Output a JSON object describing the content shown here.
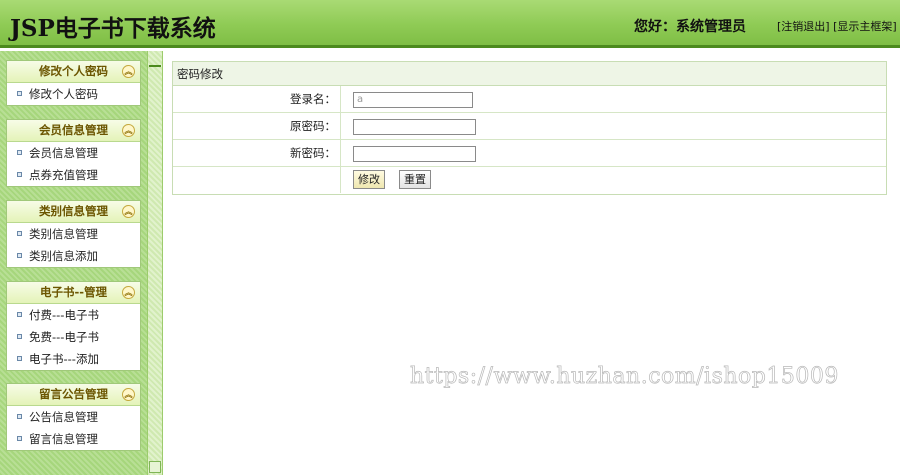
{
  "header": {
    "title": "JSP电子书下载系统",
    "greeting": "您好：系统管理员",
    "logout_link": "[注销退出]",
    "main_frame_link": "[显示主框架]"
  },
  "sidebar": {
    "groups": [
      {
        "title": "修改个人密码",
        "items": [
          "修改个人密码"
        ]
      },
      {
        "title": "会员信息管理",
        "items": [
          "会员信息管理",
          "点券充值管理"
        ]
      },
      {
        "title": "类别信息管理",
        "items": [
          "类别信息管理",
          "类别信息添加"
        ]
      },
      {
        "title": "电子书--管理",
        "items": [
          "付费---电子书",
          "免费---电子书",
          "电子书---添加"
        ]
      },
      {
        "title": "留言公告管理",
        "items": [
          "公告信息管理",
          "留言信息管理"
        ]
      }
    ],
    "collapse_glyph": "︽"
  },
  "form": {
    "caption": "密码修改",
    "fields": [
      {
        "label": "登录名：",
        "value": "a",
        "placeholder": ""
      },
      {
        "label": "原密码：",
        "value": "",
        "placeholder": ""
      },
      {
        "label": "新密码：",
        "value": "",
        "placeholder": ""
      }
    ],
    "submit_label": "修改",
    "reset_label": "重置"
  },
  "watermark": "https://www.huzhan.com/ishop15009",
  "colors": {
    "header_bg": "#8fcb55",
    "header_border": "#4c8a1e",
    "menu_title": "#6b5500"
  }
}
